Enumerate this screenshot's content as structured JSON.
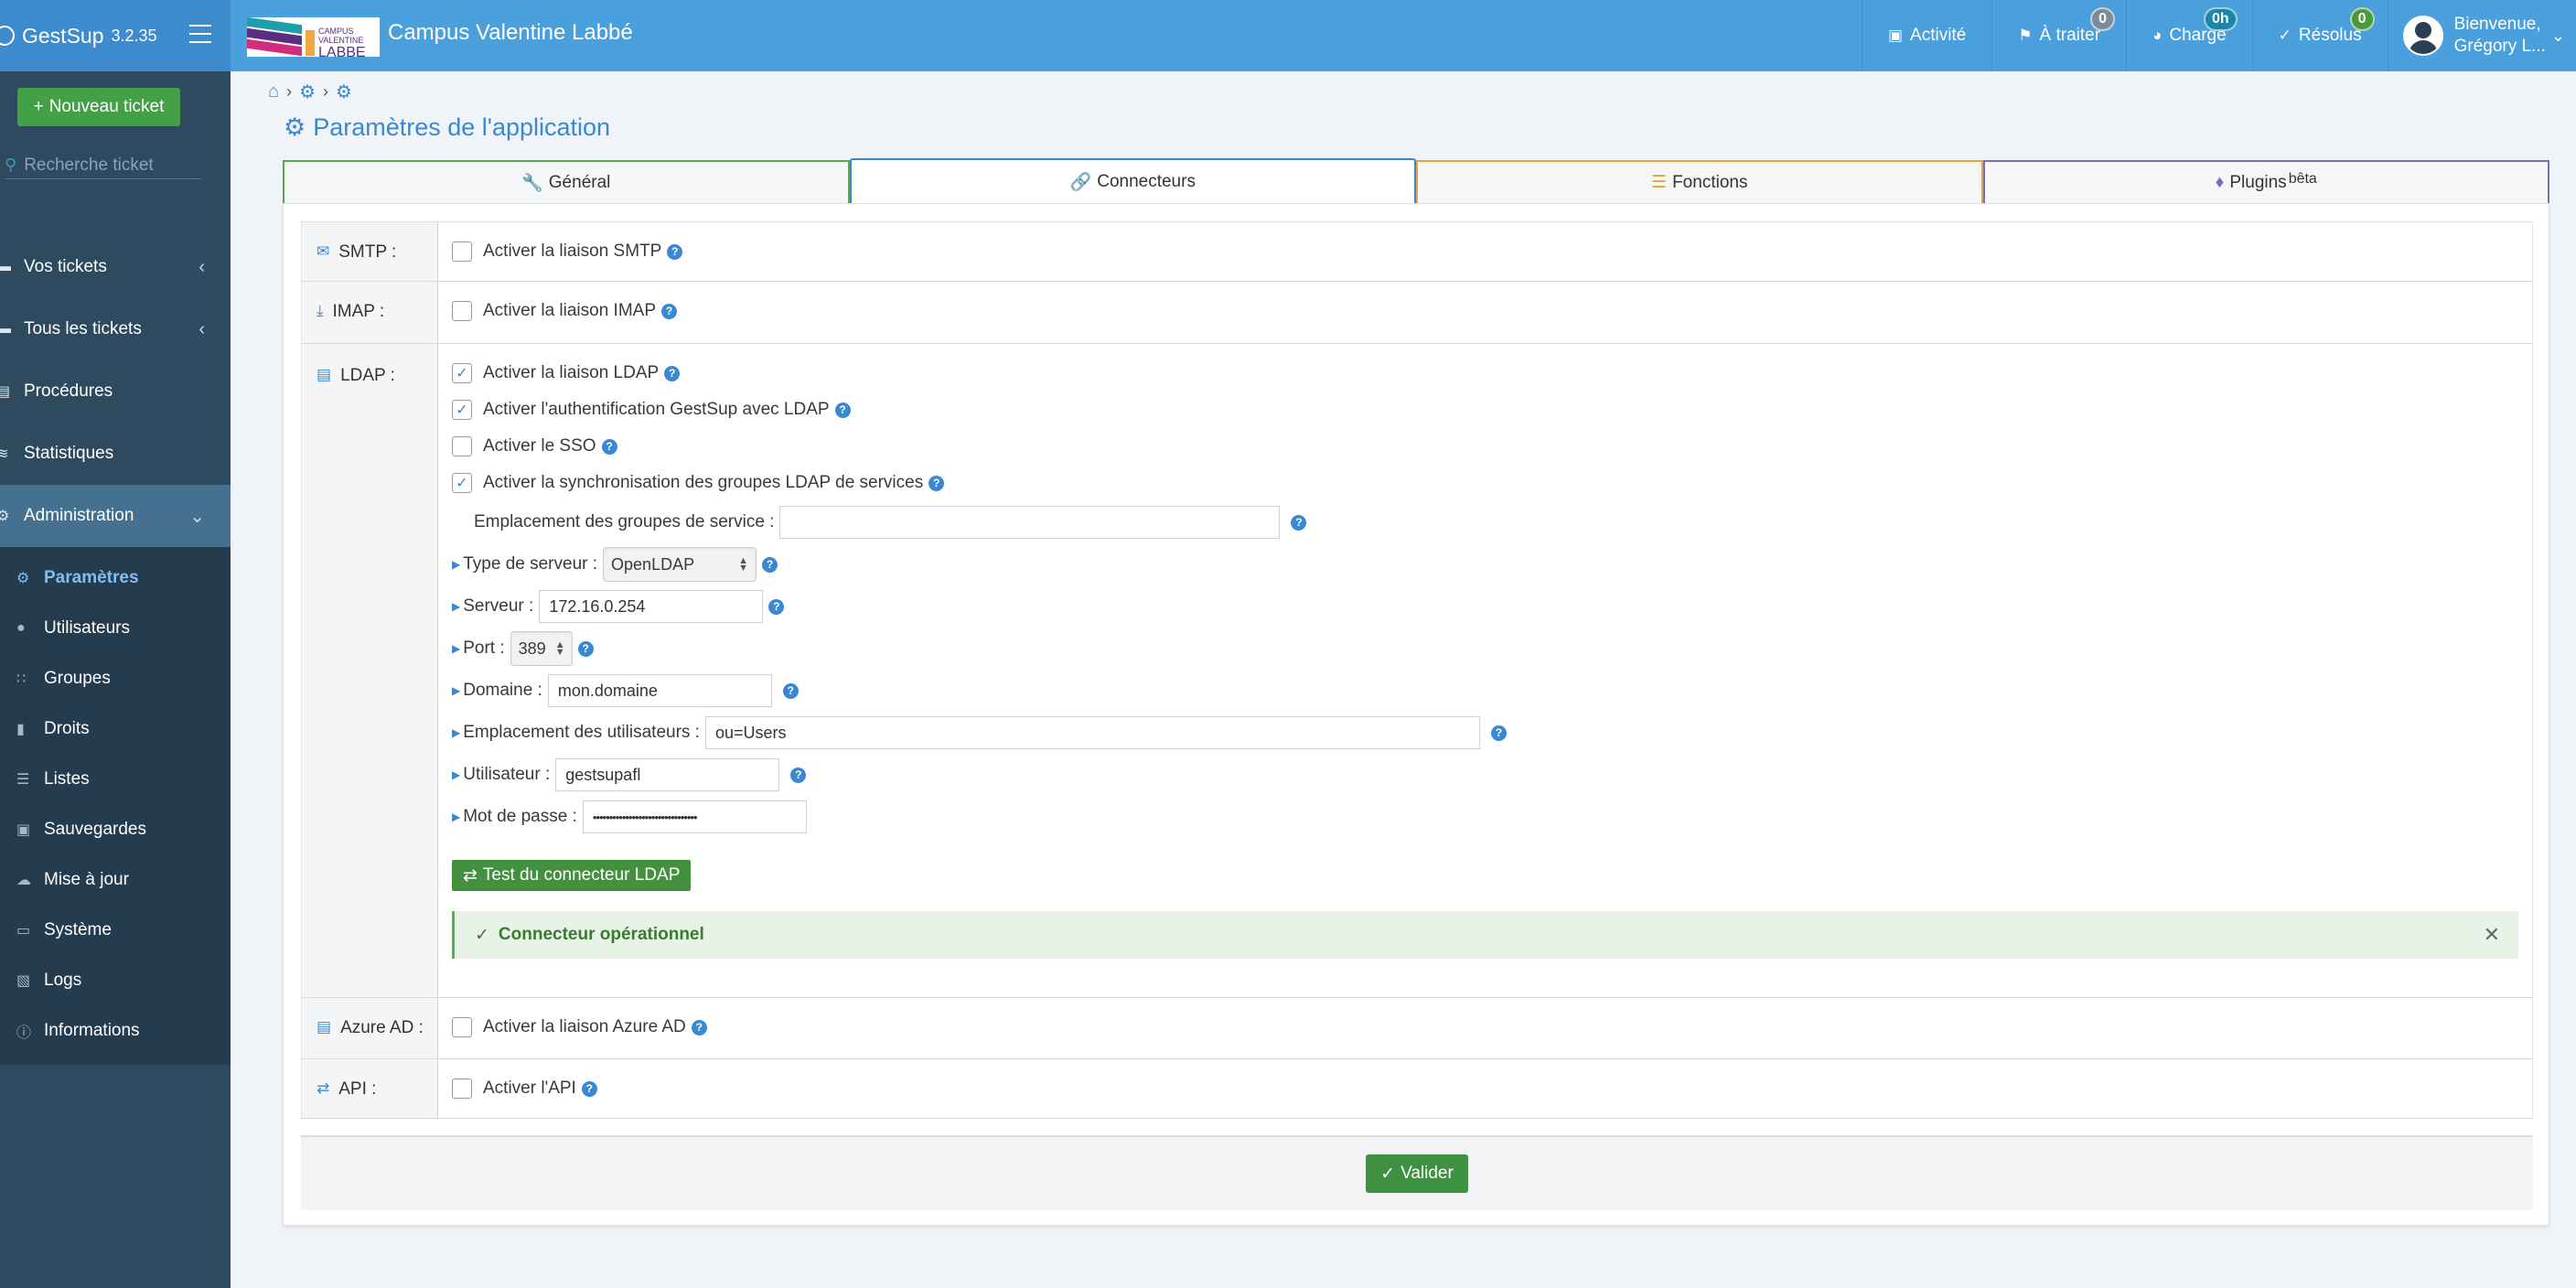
{
  "header": {
    "app_name": "GestSup",
    "version": "3.2.35",
    "campus_logo_text_small": "CAMPUS VALENTINE",
    "campus_logo_text_big": "LABBE",
    "campus_name": "Campus Valentine Labbé",
    "nav": [
      {
        "label": "Activité",
        "icon": "calendar-icon"
      },
      {
        "label": "À traiter",
        "icon": "flag-icon",
        "badge": "0",
        "badge_color": "#7d8a99"
      },
      {
        "label": "Charge",
        "icon": "gauge-icon",
        "badge": "0h",
        "badge_color": "#1a87a8"
      },
      {
        "label": "Résolus",
        "icon": "check-icon",
        "badge": "0",
        "badge_color": "#4a9a3a"
      }
    ],
    "user_greeting": "Bienvenue,",
    "user_name": "Grégory L..."
  },
  "sidebar": {
    "new_ticket_label": "Nouveau ticket",
    "search_placeholder": "Recherche ticket",
    "items": [
      {
        "label": "Vos tickets",
        "icon": "ticket-icon"
      },
      {
        "label": "Tous les tickets",
        "icon": "ticket-icon"
      },
      {
        "label": "Procédures",
        "icon": "book-icon"
      },
      {
        "label": "Statistiques",
        "icon": "chart-line-icon"
      },
      {
        "label": "Administration",
        "icon": "cogs-icon"
      }
    ],
    "admin_items": [
      {
        "label": "Paramètres",
        "icon": "gear-icon"
      },
      {
        "label": "Utilisateurs",
        "icon": "user-icon"
      },
      {
        "label": "Groupes",
        "icon": "users-icon"
      },
      {
        "label": "Droits",
        "icon": "lock-icon"
      },
      {
        "label": "Listes",
        "icon": "list-icon"
      },
      {
        "label": "Sauvegardes",
        "icon": "save-icon"
      },
      {
        "label": "Mise à jour",
        "icon": "cloud-upload-icon"
      },
      {
        "label": "Système",
        "icon": "desktop-icon"
      },
      {
        "label": "Logs",
        "icon": "clipboard-icon"
      },
      {
        "label": "Informations",
        "icon": "info-icon"
      }
    ]
  },
  "page": {
    "title": "Paramètres de l'application",
    "tabs": [
      {
        "label": "Général",
        "color": "#5aa64a"
      },
      {
        "label": "Connecteurs",
        "color": "#3a88d1"
      },
      {
        "label": "Fonctions",
        "color": "#e5a53a"
      },
      {
        "label": "Plugins",
        "sup": "bêta",
        "color": "#7b6db3"
      }
    ]
  },
  "connectors": {
    "smtp": {
      "label": "SMTP :",
      "check": "Activer la liaison SMTP",
      "checked": false
    },
    "imap": {
      "label": "IMAP :",
      "check": "Activer la liaison IMAP",
      "checked": false
    },
    "ldap": {
      "label": "LDAP :",
      "checks": [
        {
          "label": "Activer la liaison LDAP",
          "checked": true
        },
        {
          "label": "Activer l'authentification GestSup avec LDAP",
          "checked": true
        },
        {
          "label": "Activer le SSO",
          "checked": false
        },
        {
          "label": "Activer la synchronisation des groupes LDAP de services",
          "checked": true
        }
      ],
      "service_groups_label": "Emplacement des groupes de service :",
      "service_groups_value": "",
      "server_type_label": "Type de serveur :",
      "server_type_value": "OpenLDAP",
      "server_label": "Serveur :",
      "server_value": "172.16.0.254",
      "port_label": "Port :",
      "port_value": "389",
      "domain_label": "Domaine :",
      "domain_value": "mon.domaine",
      "users_location_label": "Emplacement des utilisateurs :",
      "users_location_value": "ou=Users",
      "user_label": "Utilisateur :",
      "user_value": "gestsupafl",
      "password_label": "Mot de passe :",
      "password_value": "••••••••••••••••••••••••••••••••",
      "test_button": "Test du connecteur LDAP",
      "alert_text": "Connecteur opérationnel"
    },
    "azure": {
      "label": "Azure AD :",
      "check": "Activer la liaison Azure AD",
      "checked": false
    },
    "api": {
      "label": "API :",
      "check": "Activer l'API",
      "checked": false
    }
  },
  "footer": {
    "submit_label": "Valider"
  }
}
